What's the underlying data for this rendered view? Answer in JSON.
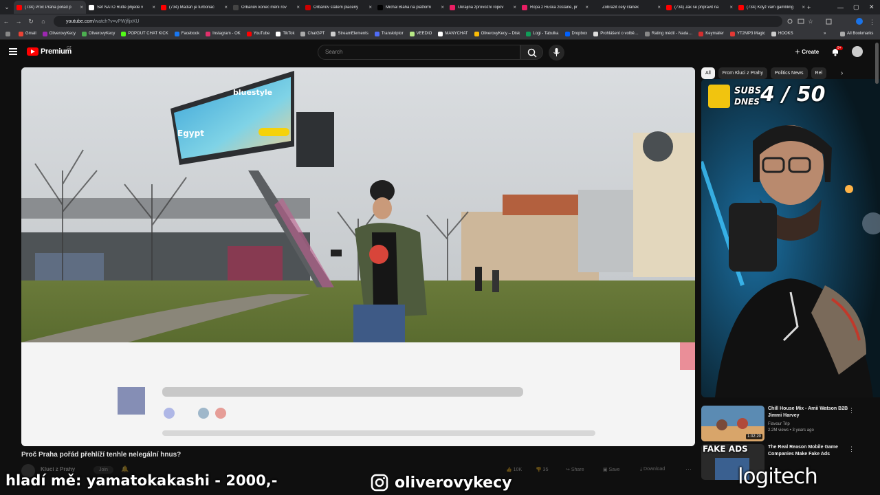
{
  "browser": {
    "tabs": [
      {
        "title": "(734) Proč Praha pořád p",
        "active": true,
        "color": "#ff0000"
      },
      {
        "title": "Šéf NATO Rutte přijede v",
        "color": "#ffffff"
      },
      {
        "title": "(734) Maďaři je turbonac",
        "color": "#ff0000"
      },
      {
        "title": "Orbánův konec mění rov",
        "color": "#444444"
      },
      {
        "title": "Orbánův státem placený",
        "color": "#cc0000"
      },
      {
        "title": "Michal Bláha na platform",
        "color": "#000000"
      },
      {
        "title": "Ukrajina zprovozní ropov",
        "color": "#e91e63"
      },
      {
        "title": "Ropa z Ruska zůstane, pr",
        "color": "#e91e63"
      },
      {
        "title": "Zobrazit celý článek",
        "color": "#202124"
      },
      {
        "title": "(734) Jak se připravit na",
        "color": "#ff0000"
      },
      {
        "title": "(734) Když vám gambling",
        "color": "#ff0000"
      }
    ],
    "url_host": "youtube.com",
    "url_path": "/watch?v=vPWjfljxKU",
    "bookmarks": [
      {
        "label": "Gmail",
        "color": "#ea4335"
      },
      {
        "label": "OliverovyKecy",
        "color": "#9c27b0"
      },
      {
        "label": "OliverovyKecy",
        "color": "#4caf50"
      },
      {
        "label": "POPOUT CHAT KICK",
        "color": "#53fc18"
      },
      {
        "label": "Facebook",
        "color": "#1877f2"
      },
      {
        "label": "Instagram - OK",
        "color": "#e1306c"
      },
      {
        "label": "YouTube",
        "color": "#ff0000"
      },
      {
        "label": "TikTok",
        "color": "#ffffff"
      },
      {
        "label": "ChatGPT",
        "color": "#aaaaaa"
      },
      {
        "label": "StreamElements",
        "color": "#cccccc"
      },
      {
        "label": "Transkriptor",
        "color": "#4f6cf7"
      },
      {
        "label": "VEEDIO",
        "color": "#b8e986"
      },
      {
        "label": "MANYCHAT",
        "color": "#ffffff"
      },
      {
        "label": "OliverovyKecy – Disk",
        "color": "#fbbc04"
      },
      {
        "label": "Logi - Tabulka",
        "color": "#0f9d58"
      },
      {
        "label": "Dropbox",
        "color": "#0061ff"
      },
      {
        "label": "Prohlášení o volbě…",
        "color": "#dddddd"
      },
      {
        "label": "Rating médií - Nada…",
        "color": "#888888"
      },
      {
        "label": "Keymailer",
        "color": "#d32f2f"
      },
      {
        "label": "YT2MP3 Magic",
        "color": "#e53935"
      },
      {
        "label": "HOOKS",
        "color": "#cccccc"
      }
    ],
    "all_bookmarks": "All Bookmarks"
  },
  "youtube": {
    "brand": "Premium",
    "region": "CZ",
    "search_placeholder": "Search",
    "create_label": "Create",
    "notif_count": "9+",
    "video_title": "Proč Praha pořád přehlíží tenhle nelegální hnus?",
    "channel_name": "Kluci z Prahy",
    "join_label": "Join",
    "likes": "10K",
    "dislikes": "35",
    "share_label": "Share",
    "save_label": "Save",
    "download_label": "Download",
    "chips": [
      {
        "label": "All",
        "active": true
      },
      {
        "label": "From Kluci z Prahy",
        "active": false
      },
      {
        "label": "Politics News",
        "active": false
      },
      {
        "label": "Rel",
        "active": false
      }
    ],
    "recommendations": [
      {
        "title": "Chill House Mix - Amii Watson B2B Jimmi Harvey",
        "channel": "Flavour Trip",
        "meta": "2.2M views • 3 years ago",
        "duration": "1:02:20"
      },
      {
        "title": "The Real Reason Mobile Game Companies Make Fake Ads",
        "channel": "",
        "meta": "",
        "duration": ""
      }
    ]
  },
  "billboard": {
    "brand": "bluestyle",
    "headline": "Egypt"
  },
  "stream_overlay": {
    "subs_label_top": "SUBS",
    "subs_label_bottom": "DNES",
    "subs_count": "4 / 50",
    "donation_text": "hladí mě: yamatokakashi - 2000,-",
    "instagram_handle": "oliverovykecy",
    "sponsor": "logitech",
    "thumb_text": "FAKE ADS"
  }
}
